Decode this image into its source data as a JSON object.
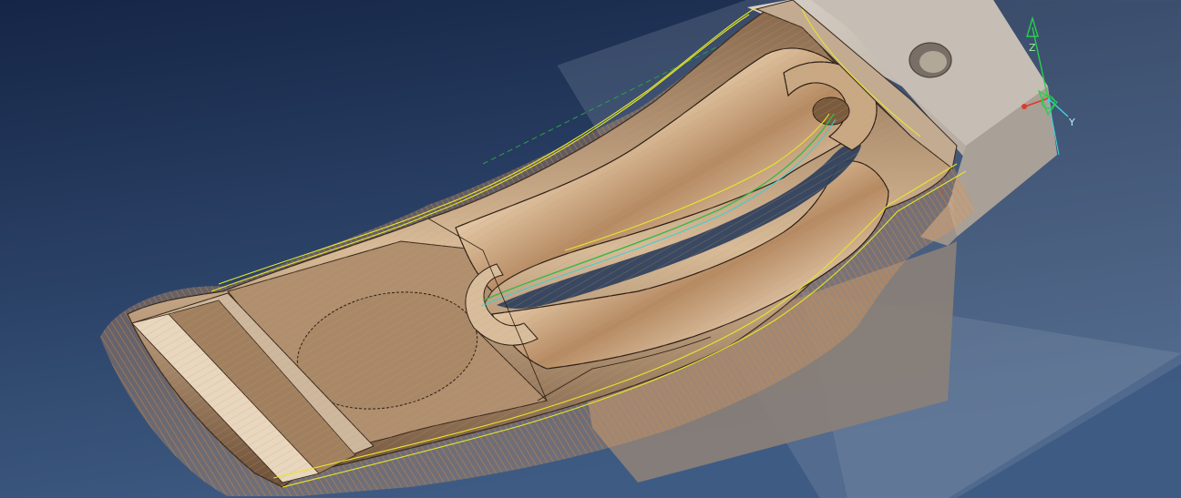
{
  "viewport": {
    "background_top": "#152546",
    "background_bottom": "#3e5b83"
  },
  "colors": {
    "stock_face": "#c9c0b6",
    "stock_side": "#a9a097",
    "part_metal": "#b58a62",
    "part_metal_light": "#e9cfae",
    "part_metal_dark": "#6d4a2c",
    "toolpath_orange": "#e07a1f",
    "toolpath_yellow": "#e6e62a",
    "toolpath_green": "#38b84a",
    "toolpath_cyan": "#36d0d8",
    "edge_dark": "#2b1e14",
    "axis_z": "#25d04a",
    "axis_y": "#37d7e0",
    "axis_x": "#e03a2a"
  },
  "triad": {
    "z_label": "Z",
    "y_label": "Y"
  }
}
